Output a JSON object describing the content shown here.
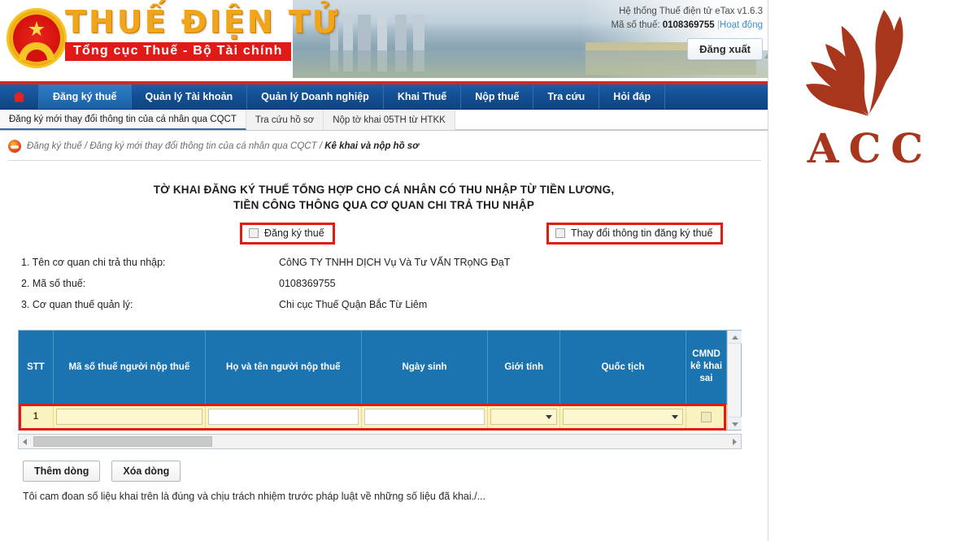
{
  "header": {
    "brand_main": "THUẾ ĐIỆN TỬ",
    "brand_sub": "Tổng cục Thuế - Bộ Tài chính",
    "system_line": "Hệ thống Thuế điện tử eTax v1.6.3",
    "tax_code_label": "Mã số thuế:",
    "tax_code_value": "0108369755",
    "separator": "|",
    "status_link": "Hoạt động",
    "logout_label": "Đăng xuất",
    "emblem_icon": "vietnam-tax-emblem-icon",
    "home_icon": "home-icon"
  },
  "nav": {
    "items": [
      {
        "label": "Đăng ký thuế",
        "active": true
      },
      {
        "label": "Quản lý Tài khoản",
        "active": false
      },
      {
        "label": "Quản lý Doanh nghiệp",
        "active": false
      },
      {
        "label": "Khai Thuế",
        "active": false
      },
      {
        "label": "Nộp thuế",
        "active": false
      },
      {
        "label": "Tra cứu",
        "active": false
      },
      {
        "label": "Hỏi đáp",
        "active": false
      }
    ]
  },
  "subnav": {
    "items": [
      {
        "label": "Đăng ký mới thay đổi thông tin của cá nhân qua CQCT",
        "active": true
      },
      {
        "label": "Tra cứu hồ sơ",
        "active": false
      },
      {
        "label": "Nộp tờ khai 05TH từ HTKK",
        "active": false
      }
    ]
  },
  "breadcrumb": {
    "icon": "notice-icon",
    "trail": "Đăng ký thuế / Đăng ký mới thay đổi thông tin của cá nhân qua CQCT / ",
    "current": "Kê khai và nộp hồ sơ"
  },
  "form": {
    "title_line1": "TỜ KHAI ĐĂNG KÝ THUẾ TỔNG HỢP CHO CÁ NHÂN CÓ THU NHẬP TỪ TIỀN LƯƠNG,",
    "title_line2": "TIỀN CÔNG THÔNG QUA CƠ QUAN CHI TRẢ THU NHẬP",
    "checkboxes": [
      {
        "label": "Đăng ký thuế",
        "checked": false,
        "highlight_color": "#e01b14"
      },
      {
        "label": "Thay đổi thông tin đăng ký thuế",
        "checked": false,
        "highlight_color": "#e01b14"
      }
    ],
    "info_rows": [
      {
        "label": "1. Tên cơ quan chi trả thu nhập:",
        "value": "CôNG TY TNHH DỊCH Vụ Và Tư VẤN TRọNG ĐạT"
      },
      {
        "label": "2. Mã số thuế:",
        "value": "0108369755"
      },
      {
        "label": "3. Cơ quan thuế quản lý:",
        "value": "Chi cục Thuế Quận Bắc Từ Liêm"
      }
    ]
  },
  "grid": {
    "columns": [
      "STT",
      "Mã số thuế người nộp thuế",
      "Họ và tên người nộp thuế",
      "Ngày sinh",
      "Giới tính",
      "Quốc tịch",
      "CMND kê khai sai"
    ],
    "rows": [
      {
        "stt": "1",
        "ma_so_thue": "",
        "ho_ten": "",
        "ngay_sinh": "",
        "gioi_tinh": "",
        "quoc_tich": "",
        "cmnd_sai": false
      }
    ],
    "header_bg": "#1b73b0",
    "row_bg": "#fbf3bf"
  },
  "actions": {
    "add_row_label": "Thêm dòng",
    "delete_row_label": "Xóa dòng",
    "pledge_text": "Tôi cam đoan số liệu khai trên là đúng và chịu trách nhiệm trước pháp luật về những số liệu đã khai./..."
  },
  "logo": {
    "name": "ACC",
    "icon": "acc-flame-logo-icon",
    "color": "#a8361c"
  }
}
